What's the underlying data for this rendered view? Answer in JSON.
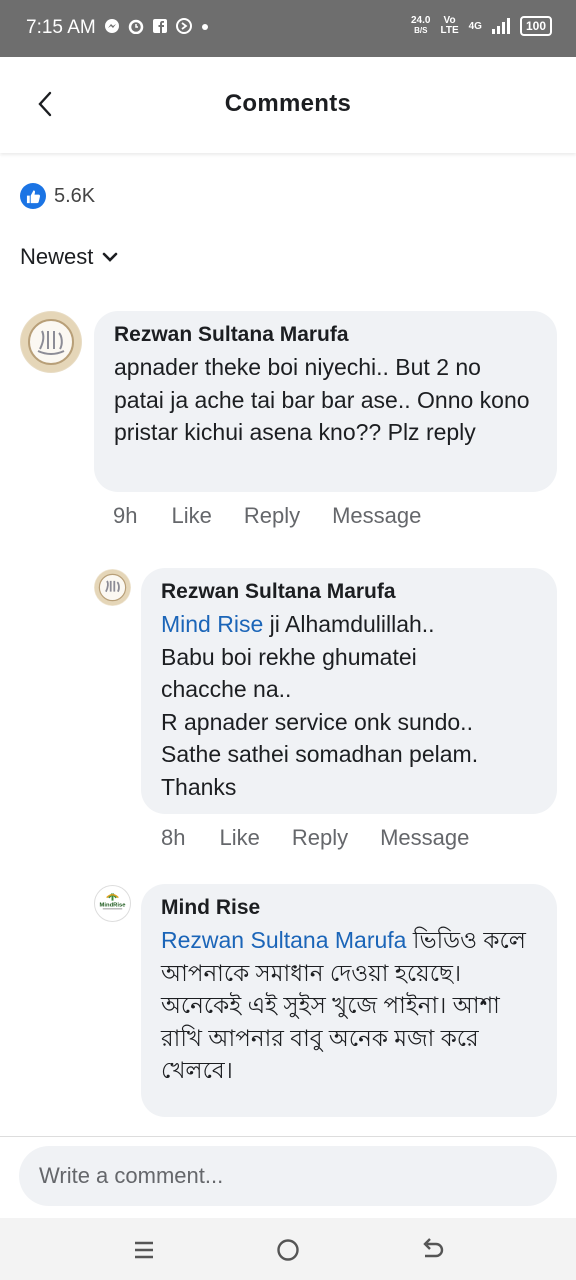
{
  "status_bar": {
    "time": "7:15 AM",
    "net_speed": "24.0",
    "net_unit": "B/S",
    "volte": "Vo",
    "lte": "LTE",
    "network": "4G",
    "battery": "100",
    "icons": [
      "messenger-icon",
      "alarm-icon",
      "facebook-icon",
      "shazam-icon",
      "dot-icon"
    ]
  },
  "header": {
    "title": "Comments"
  },
  "reactions": {
    "count": "5.6K",
    "icon": "like-icon",
    "color": "#1b74e4"
  },
  "sort": {
    "label": "Newest"
  },
  "comments": [
    {
      "author": "Rezwan Sultana Marufa",
      "text": "apnader theke boi niyechi.. But 2 no patai ja ache tai bar bar ase.. Onno kono pristar kichui asena kno?? Plz reply",
      "time": "9h",
      "like": "Like",
      "reply": "Reply",
      "message": "Message"
    },
    {
      "author": "Rezwan Sultana Marufa",
      "mention": "Mind Rise",
      "text_lines": [
        "ji Alhamdulillah..",
        "Babu boi rekhe ghumatei",
        "chacche na..",
        "R apnader service onk sundo..",
        "Sathe sathei somadhan pelam.",
        "Thanks"
      ],
      "time": "8h",
      "like": "Like",
      "reply": "Reply",
      "message": "Message"
    },
    {
      "author": "Mind Rise",
      "mention": "Rezwan Sultana Marufa",
      "text": "ভিডিও কলে আপনাকে সমাধান দেওয়া হয়েছে। অনেকেই এই সুইস খুজে পাইনা। আশা রাখি আপনার বাবু অনেক মজা করে খেলবে।",
      "avatar_text": "MindRise"
    }
  ],
  "composer": {
    "placeholder": "Write a comment..."
  },
  "nav": [
    "menu-icon",
    "home-icon",
    "back-icon"
  ],
  "colors": {
    "mention": "#1b65b8",
    "status_bar": "#6e6e6e",
    "bubble": "#f0f2f5"
  }
}
